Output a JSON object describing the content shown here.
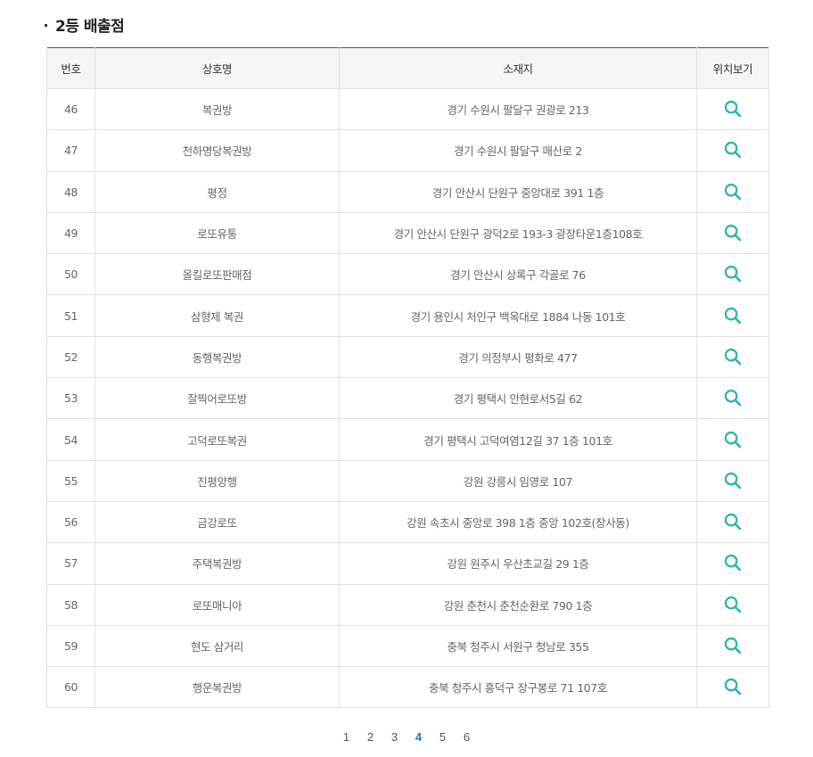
{
  "section": {
    "title": "2등 배출점"
  },
  "table": {
    "headers": {
      "no": "번호",
      "name": "상호명",
      "address": "소재지",
      "location": "위치보기"
    },
    "rows": [
      {
        "no": "46",
        "name": "복권방",
        "address": "경기 수원시 팔달구 권광로 213"
      },
      {
        "no": "47",
        "name": "천하명당복권방",
        "address": "경기 수원시 팔달구 매산로 2"
      },
      {
        "no": "48",
        "name": "평정",
        "address": "경기 안산시 단원구 중앙대로 391 1층"
      },
      {
        "no": "49",
        "name": "로또유통",
        "address": "경기 안산시 단원구 광덕2로 193-3 광장타운1층108호"
      },
      {
        "no": "50",
        "name": "올킬로또판매점",
        "address": "경기 안산시 상록구 각골로 76"
      },
      {
        "no": "51",
        "name": "삼형제 복권",
        "address": "경기 용인시 처인구 백옥대로 1884 나동 101호"
      },
      {
        "no": "52",
        "name": "동행복권방",
        "address": "경기 의정부시 평화로 477"
      },
      {
        "no": "53",
        "name": "잘찍어로또방",
        "address": "경기 평택시 안현로서5길 62"
      },
      {
        "no": "54",
        "name": "고덕로또복권",
        "address": "경기 평택시 고덕여염12길 37 1층 101호"
      },
      {
        "no": "55",
        "name": "진평양행",
        "address": "강원 강릉시 임영로 107"
      },
      {
        "no": "56",
        "name": "금강로또",
        "address": "강원 속초시 중앙로 398 1층 중앙 102호(장사동)"
      },
      {
        "no": "57",
        "name": "주택복권방",
        "address": "강원 원주시 우산초교길 29 1층"
      },
      {
        "no": "58",
        "name": "로또매니아",
        "address": "강원 춘천시 춘천순환로 790 1층"
      },
      {
        "no": "59",
        "name": "현도 삼거리",
        "address": "충북 청주시 서원구 청남로 355"
      },
      {
        "no": "60",
        "name": "행운복권방",
        "address": "충북 청주시 흥덕구 장구봉로 71 107호"
      }
    ]
  },
  "pagination": {
    "pages": [
      "1",
      "2",
      "3",
      "4",
      "5",
      "6"
    ],
    "current": "4"
  },
  "icons": {
    "location": "search-icon"
  },
  "colors": {
    "icon": "#2bb5a6",
    "active_page": "#1a73c8",
    "header_bg": "#f5f5f5"
  }
}
